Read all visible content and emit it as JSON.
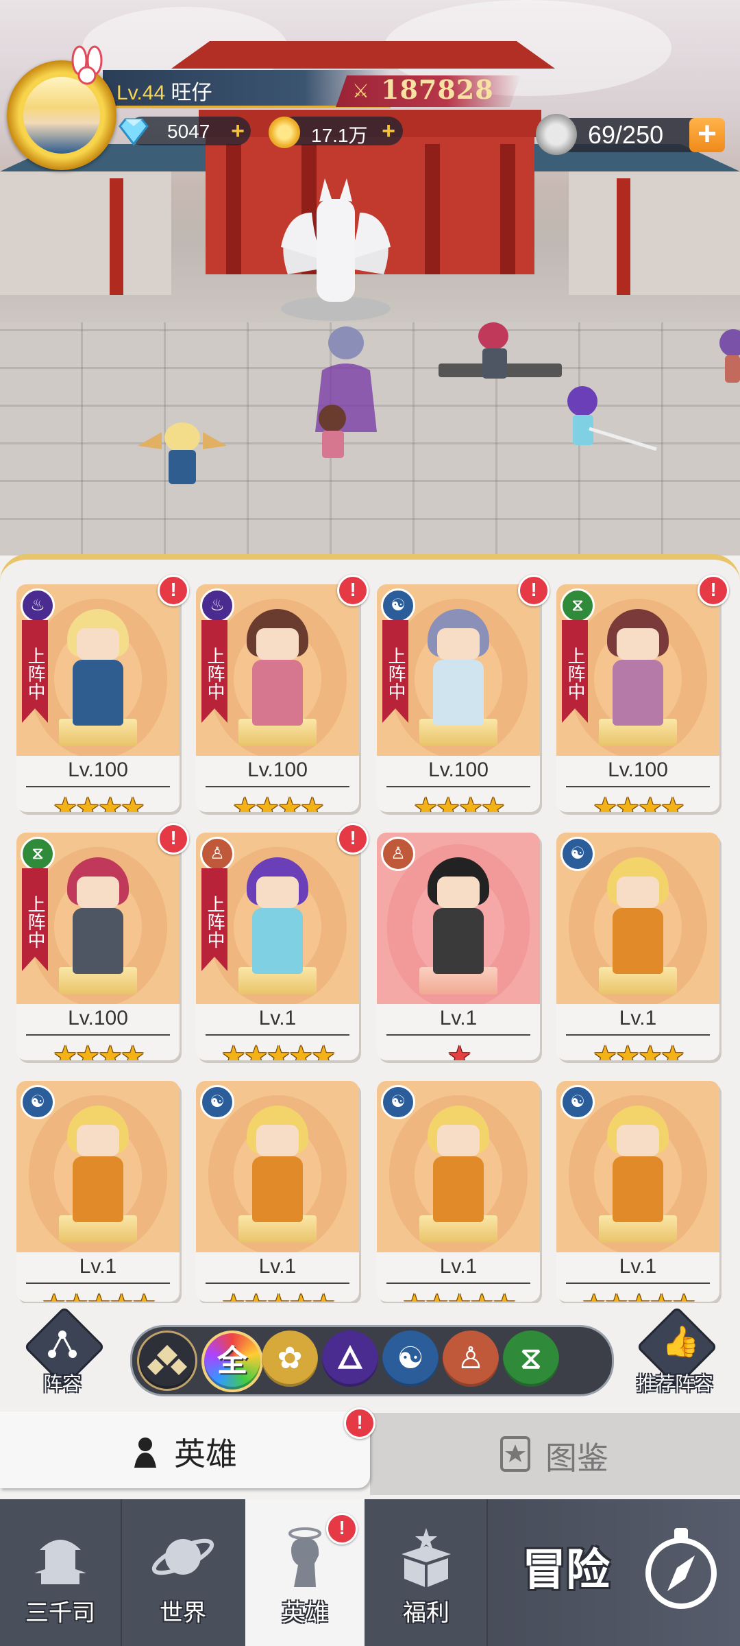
{
  "player": {
    "level_prefix": "Lv.44",
    "name": "旺仔",
    "power": "187828"
  },
  "resources": {
    "gems": "5047",
    "gold": "17.1万",
    "stamina": "69/250"
  },
  "hero_cards": [
    {
      "level": "Lv.100",
      "stars": 4,
      "element": "fire",
      "deployed": true,
      "alert": true
    },
    {
      "level": "Lv.100",
      "stars": 4,
      "element": "fire",
      "deployed": true,
      "alert": true
    },
    {
      "level": "Lv.100",
      "stars": 4,
      "element": "water",
      "deployed": true,
      "alert": true
    },
    {
      "level": "Lv.100",
      "stars": 4,
      "element": "nature",
      "deployed": true,
      "alert": true
    },
    {
      "level": "Lv.100",
      "stars": 4,
      "element": "nature",
      "deployed": true,
      "alert": true
    },
    {
      "level": "Lv.1",
      "stars": 5,
      "element": "light",
      "deployed": true,
      "alert": true
    },
    {
      "level": "Lv.1",
      "stars": 1,
      "element": "light",
      "deployed": false,
      "alert": false
    },
    {
      "level": "Lv.1",
      "stars": 4,
      "element": "water",
      "deployed": false,
      "alert": false
    },
    {
      "level": "Lv.1",
      "stars": 5,
      "element": "water",
      "deployed": false,
      "alert": false
    },
    {
      "level": "Lv.1",
      "stars": 5,
      "element": "water",
      "deployed": false,
      "alert": false
    },
    {
      "level": "Lv.1",
      "stars": 5,
      "element": "water",
      "deployed": false,
      "alert": false
    },
    {
      "level": "Lv.1",
      "stars": 5,
      "element": "water",
      "deployed": false,
      "alert": false
    }
  ],
  "deployed_label": "上阵中",
  "filters": {
    "formation_label": "阵容",
    "recommend_label": "推荐阵容",
    "all_label": "全"
  },
  "subtabs": {
    "hero": "英雄",
    "gallery": "图鉴"
  },
  "nav": {
    "items": [
      "三千司",
      "世界",
      "英雄",
      "福利"
    ],
    "adventure": "冒险"
  },
  "colors": {
    "fire": "#4a2b8f",
    "water": "#2a5d9a",
    "nature": "#2f8a3a",
    "light": "#c0593a",
    "star": "#f3b318",
    "banner": "#b8233a",
    "alert": "#e63946"
  }
}
